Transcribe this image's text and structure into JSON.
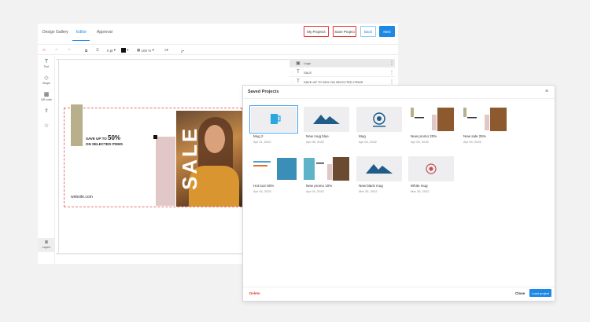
{
  "tabs": [
    "Design Gallery",
    "Editor",
    "Approval"
  ],
  "top_buttons": {
    "my_projects": "My Projects",
    "save_project": "Save Project",
    "back": "Back",
    "next": "Next"
  },
  "toolbar": {
    "stroke": "0 pt",
    "opacity": "100 %"
  },
  "left_rail": [
    "Text",
    "Shape",
    "QR code",
    "",
    "",
    "Layers"
  ],
  "layers": [
    {
      "name": "Logo",
      "type": "image"
    },
    {
      "name": "SALE",
      "type": "text"
    },
    {
      "name": "SAVE UP TO 50% ON SELECTED ITEMS",
      "type": "text"
    }
  ],
  "banner": {
    "save_prefix": "SAVE UP TO ",
    "save_percent": "50%",
    "save_line2": "ON SELECTED ITEMS",
    "sale": "SALE",
    "website": "website.com"
  },
  "modal": {
    "title": "Saved Projects",
    "delete": "Delete",
    "close": "Close",
    "load": "Load project",
    "projects": [
      {
        "name": "Mug 2",
        "date": "Apr 11, 2022"
      },
      {
        "name": "New mug blue",
        "date": "Apr 08, 2022"
      },
      {
        "name": "Mug",
        "date": "Apr 04, 2022"
      },
      {
        "name": "New promo 20%",
        "date": "Apr 04, 2022"
      },
      {
        "name": "New sale 25%",
        "date": "Apr 04, 2022"
      },
      {
        "name": "Hot tour 50%",
        "date": "Apr 04, 2022"
      },
      {
        "name": "New promo 10%",
        "date": "Apr 04, 2022"
      },
      {
        "name": "New black mug",
        "date": "Mar 25, 2022"
      },
      {
        "name": "White mug",
        "date": "Mar 25, 2022"
      }
    ]
  },
  "colors": {
    "accent": "#1e88e5",
    "danger": "#e53935"
  }
}
